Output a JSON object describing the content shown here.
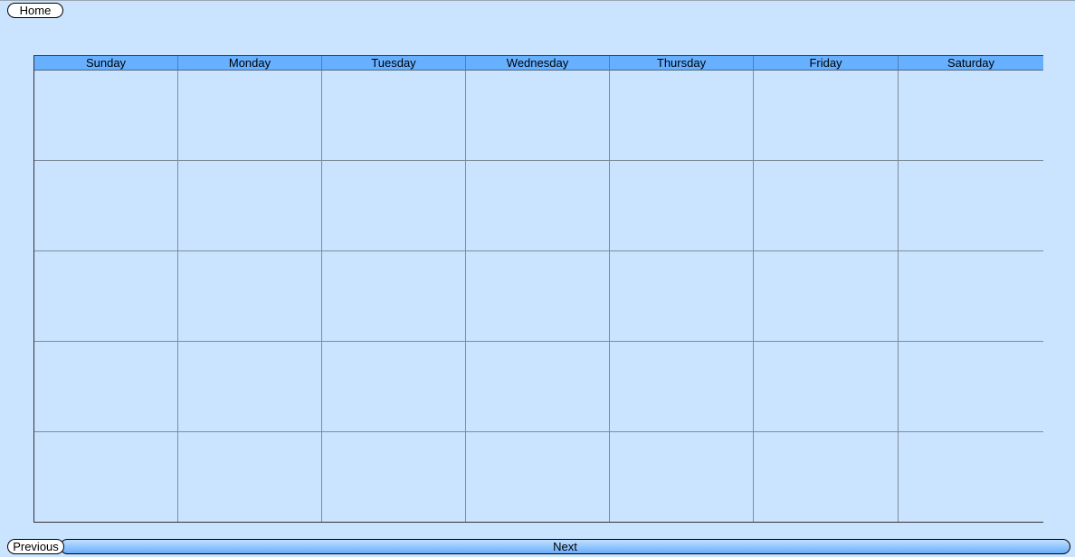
{
  "nav": {
    "home_label": "Home",
    "previous_label": "Previous",
    "next_label": "Next"
  },
  "calendar": {
    "days": [
      "Sunday",
      "Monday",
      "Tuesday",
      "Wednesday",
      "Thursday",
      "Friday",
      "Saturday"
    ],
    "weeks": 5
  },
  "colors": {
    "background": "#cae4ff",
    "header": "#66b0ff",
    "next_bar_top": "#bfe0ff",
    "next_bar_bottom": "#6aaefc"
  }
}
